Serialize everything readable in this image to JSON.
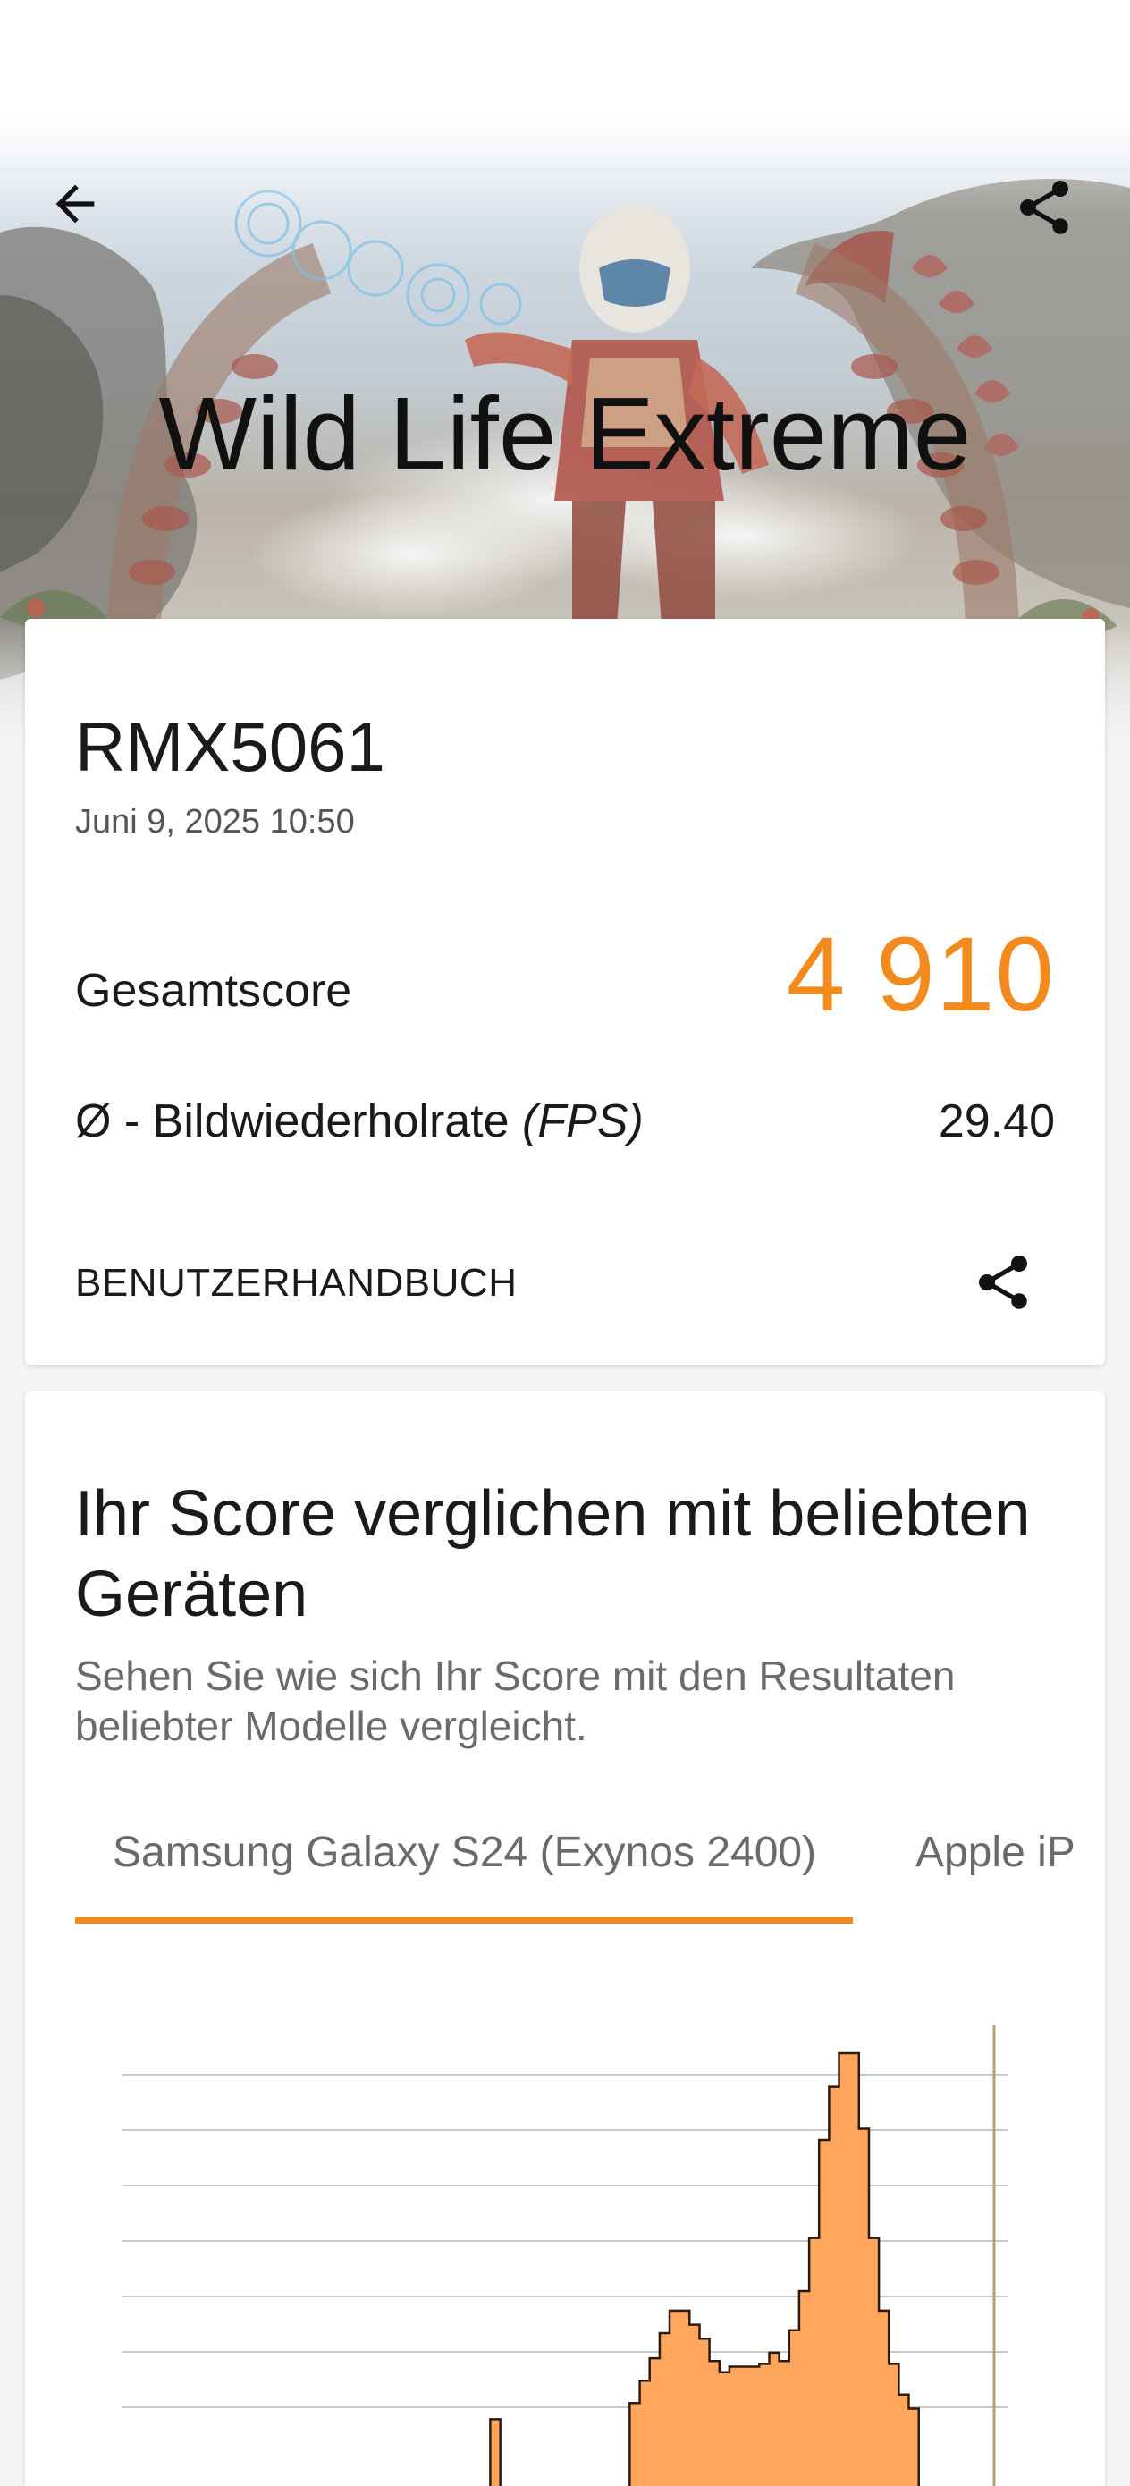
{
  "header": {
    "title": "Wild Life Extreme",
    "back_icon": "arrow-left-icon",
    "share_icon": "share-icon"
  },
  "result": {
    "device": "RMX5061",
    "date": "Juni 9, 2025 10:50",
    "score_label": "Gesamtscore",
    "score_value": "4 910",
    "fps_label_prefix": "Ø - Bildwiederholrate ",
    "fps_label_unit": "(FPS)",
    "fps_value": "29.40",
    "manual_label": "BENUTZERHANDBUCH",
    "accent_color": "#f28a1e"
  },
  "comparison": {
    "title": "Ihr Score verglichen mit beliebten Geräten",
    "subtitle": "Sehen Sie wie sich Ihr Score mit den Resultaten beliebter Modelle vergleicht.",
    "tabs": [
      {
        "label": "Samsung Galaxy S24 (Exynos 2400)",
        "selected": true
      },
      {
        "label": "Apple iP",
        "selected": false
      }
    ]
  },
  "chart_data": {
    "type": "area",
    "title": "",
    "xlabel": "",
    "ylabel": "",
    "grid": true,
    "fill_color": "#ffa55c",
    "stroke_color": "#2a1a10",
    "marker_color": "#b8a070",
    "series": [
      {
        "values": [
          0,
          0,
          0,
          0,
          0,
          0,
          0,
          0,
          0,
          0,
          0,
          0,
          0,
          0,
          0,
          0,
          0,
          0,
          0,
          0,
          0,
          0,
          0,
          0,
          0,
          0,
          0,
          0,
          0,
          0,
          0,
          0,
          0,
          0,
          0,
          0,
          0,
          0.01,
          0,
          0,
          0,
          0,
          0,
          0,
          0,
          0,
          0,
          0,
          0,
          0,
          0,
          0.3,
          0.7,
          1.1,
          1.55,
          1.95,
          1.95,
          1.7,
          1.45,
          1.05,
          0.85,
          0.95,
          0.95,
          0.95,
          1.0,
          1.2,
          1.05,
          1.6,
          2.3,
          3.25,
          5.0,
          5.95,
          6.55,
          6.55,
          5.2,
          3.25,
          1.95,
          1.0,
          0.45,
          0.2,
          0,
          0,
          0,
          0,
          0,
          0,
          0,
          0,
          0
        ]
      }
    ]
  }
}
